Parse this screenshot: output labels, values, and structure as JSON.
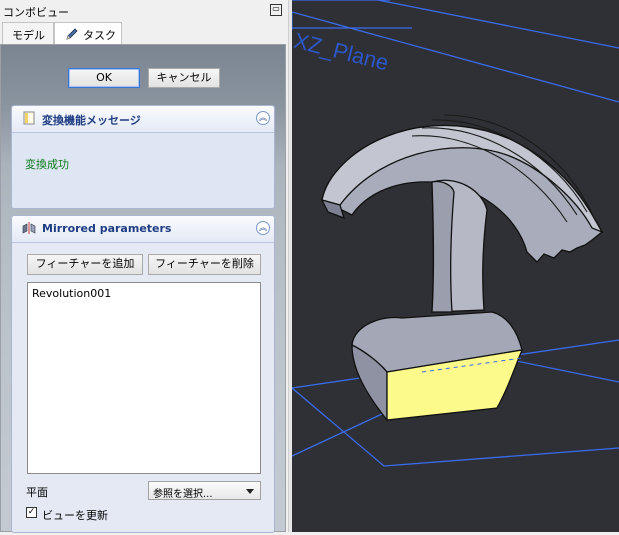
{
  "combo": {
    "title": "コンボビュー",
    "tabs": [
      {
        "label": "モデル"
      },
      {
        "label": "タスク"
      }
    ]
  },
  "task": {
    "ok_label": "OK",
    "cancel_label": "キャンセル",
    "message_panel": {
      "title": "変換機能メッセージ",
      "text": "変換成功"
    },
    "mirrored_panel": {
      "title": "Mirrored parameters",
      "add_feature_label": "フィーチャーを追加",
      "remove_feature_label": "フィーチャーを削除",
      "features": [
        "Revolution001"
      ],
      "plane_label": "平面",
      "plane_value": "参照を選択...",
      "update_view_label": "ビューを更新",
      "update_view_checked": true
    }
  },
  "view3d": {
    "plane_label": "XZ_Plane",
    "colors": {
      "background": "#2f3035",
      "plane_lines": "#3a6cf0",
      "model_face": "#b8bbc6",
      "selected_face": "#fbfa8a"
    }
  }
}
